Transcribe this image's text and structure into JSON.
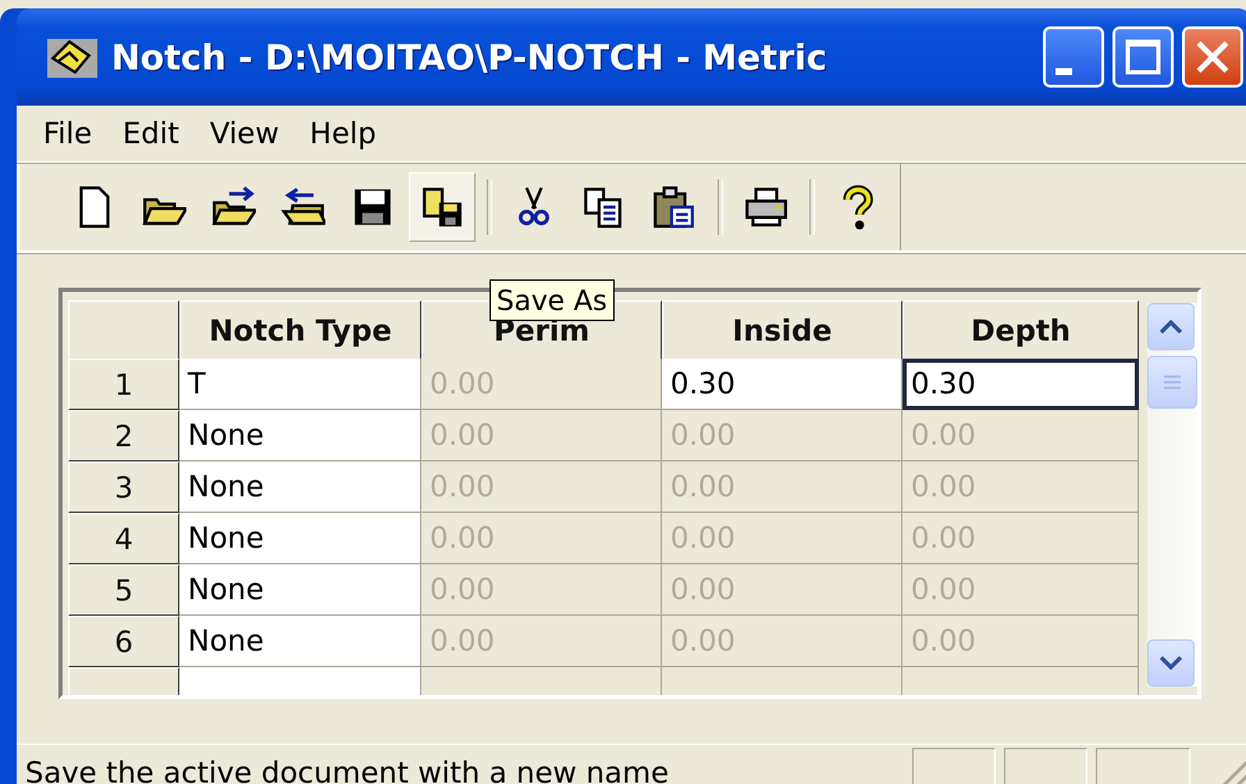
{
  "window": {
    "title": "Notch - D:\\MOITAO\\P-NOTCH - Metric"
  },
  "menu": [
    "File",
    "Edit",
    "View",
    "Help"
  ],
  "toolbar": [
    {
      "kind": "new",
      "pressed": false
    },
    {
      "kind": "open",
      "pressed": false
    },
    {
      "kind": "import",
      "pressed": false
    },
    {
      "kind": "export",
      "pressed": false
    },
    {
      "kind": "save",
      "pressed": false
    },
    {
      "kind": "save-as",
      "pressed": true
    },
    {
      "kind": "separator"
    },
    {
      "kind": "cut",
      "pressed": false
    },
    {
      "kind": "copy",
      "pressed": false
    },
    {
      "kind": "paste",
      "pressed": false
    },
    {
      "kind": "separator"
    },
    {
      "kind": "print",
      "pressed": false
    },
    {
      "kind": "separator"
    },
    {
      "kind": "help",
      "pressed": false
    }
  ],
  "tooltip": "Save As",
  "grid": {
    "columns": [
      "Notch Type",
      "Perim",
      "Inside",
      "Depth"
    ],
    "rows": [
      {
        "number": "1",
        "cells": [
          {
            "text": "T",
            "disabled": false,
            "selected": false
          },
          {
            "text": "0.00",
            "disabled": true,
            "selected": false
          },
          {
            "text": "0.30",
            "disabled": false,
            "selected": false
          },
          {
            "text": "0.30",
            "disabled": false,
            "selected": true
          }
        ]
      },
      {
        "number": "2",
        "cells": [
          {
            "text": "None",
            "disabled": false,
            "selected": false
          },
          {
            "text": "0.00",
            "disabled": true,
            "selected": false
          },
          {
            "text": "0.00",
            "disabled": true,
            "selected": false
          },
          {
            "text": "0.00",
            "disabled": true,
            "selected": false
          }
        ]
      },
      {
        "number": "3",
        "cells": [
          {
            "text": "None",
            "disabled": false,
            "selected": false
          },
          {
            "text": "0.00",
            "disabled": true,
            "selected": false
          },
          {
            "text": "0.00",
            "disabled": true,
            "selected": false
          },
          {
            "text": "0.00",
            "disabled": true,
            "selected": false
          }
        ]
      },
      {
        "number": "4",
        "cells": [
          {
            "text": "None",
            "disabled": false,
            "selected": false
          },
          {
            "text": "0.00",
            "disabled": true,
            "selected": false
          },
          {
            "text": "0.00",
            "disabled": true,
            "selected": false
          },
          {
            "text": "0.00",
            "disabled": true,
            "selected": false
          }
        ]
      },
      {
        "number": "5",
        "cells": [
          {
            "text": "None",
            "disabled": false,
            "selected": false
          },
          {
            "text": "0.00",
            "disabled": true,
            "selected": false
          },
          {
            "text": "0.00",
            "disabled": true,
            "selected": false
          },
          {
            "text": "0.00",
            "disabled": true,
            "selected": false
          }
        ]
      },
      {
        "number": "6",
        "cells": [
          {
            "text": "None",
            "disabled": false,
            "selected": false
          },
          {
            "text": "0.00",
            "disabled": true,
            "selected": false
          },
          {
            "text": "0.00",
            "disabled": true,
            "selected": false
          },
          {
            "text": "0.00",
            "disabled": true,
            "selected": false
          }
        ]
      }
    ]
  },
  "status_bar": {
    "message": "Save the active document with a new name"
  }
}
